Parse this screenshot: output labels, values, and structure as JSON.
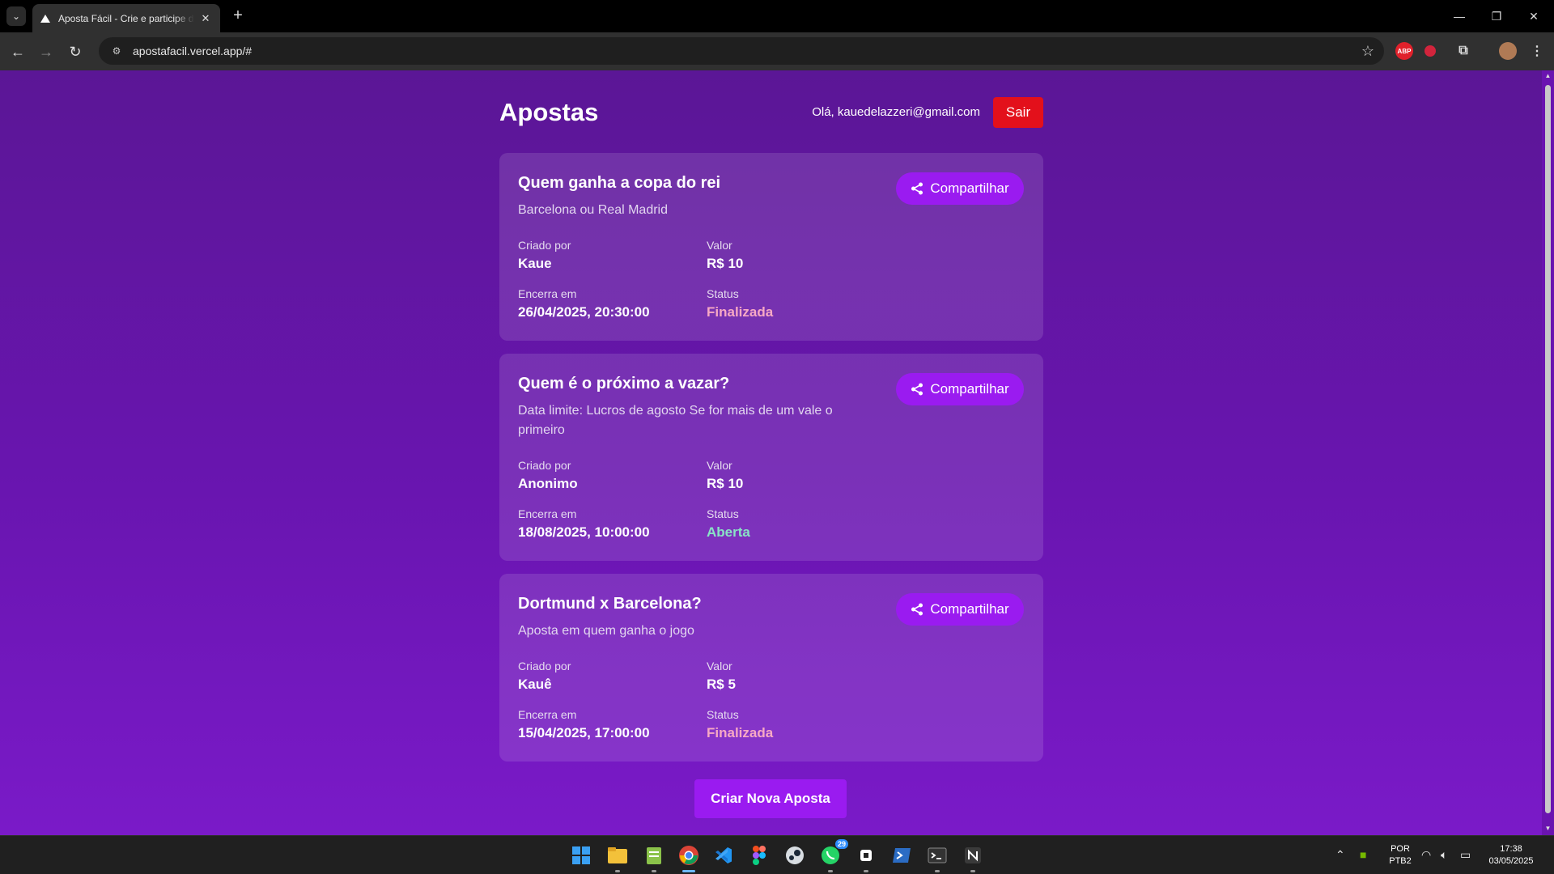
{
  "browser": {
    "tab_title": "Aposta Fácil - Crie e participe de apostas",
    "url": "apostafacil.vercel.app/#",
    "extensions": [
      "adblock-icon",
      "record-icon",
      "puzzle-icon",
      "profile-avatar"
    ],
    "extension_text": {
      "adblock": "ABP"
    }
  },
  "header": {
    "title": "Apostas",
    "greeting": "Olá, kauedelazzeri@gmail.com",
    "logout_label": "Sair"
  },
  "labels": {
    "share": "Compartilhar",
    "created_by": "Criado por",
    "value": "Valor",
    "ends_at": "Encerra em",
    "status": "Status"
  },
  "bets": [
    {
      "title": "Quem ganha a copa do rei",
      "description": "Barcelona ou Real Madrid",
      "creator": "Kaue",
      "value": "R$ 10",
      "ends_at": "26/04/2025, 20:30:00",
      "status": "Finalizada",
      "status_color": "#f7a9c4"
    },
    {
      "title": "Quem é o próximo a vazar?",
      "description": "Data limite: Lucros de agosto Se for mais de um vale o primeiro",
      "creator": "Anonimo",
      "value": "R$ 10",
      "ends_at": "18/08/2025, 10:00:00",
      "status": "Aberta",
      "status_color": "#89e3c6"
    },
    {
      "title": "Dortmund x Barcelona?",
      "description": "Aposta em quem ganha o jogo",
      "creator": "Kauê",
      "value": "R$ 5",
      "ends_at": "15/04/2025, 17:00:00",
      "status": "Finalizada",
      "status_color": "#f7a9c4"
    }
  ],
  "create_button_label": "Criar Nova Aposta",
  "colors": {
    "accent": "#9a1bf0",
    "danger": "#e3101b",
    "background_top": "#5b1696",
    "background_bottom": "#7a1ac8"
  },
  "taskbar": {
    "apps": [
      "windows-start-icon",
      "file-explorer-icon",
      "notepad-icon",
      "chrome-icon",
      "vscode-icon",
      "figma-icon",
      "steam-icon",
      "whatsapp-icon",
      "app-icon",
      "powershell-icon",
      "terminal-icon",
      "notion-icon"
    ],
    "whatsapp_badge": "29",
    "language": "POR",
    "layout": "PTB2",
    "time": "17:38",
    "date": "03/05/2025"
  }
}
